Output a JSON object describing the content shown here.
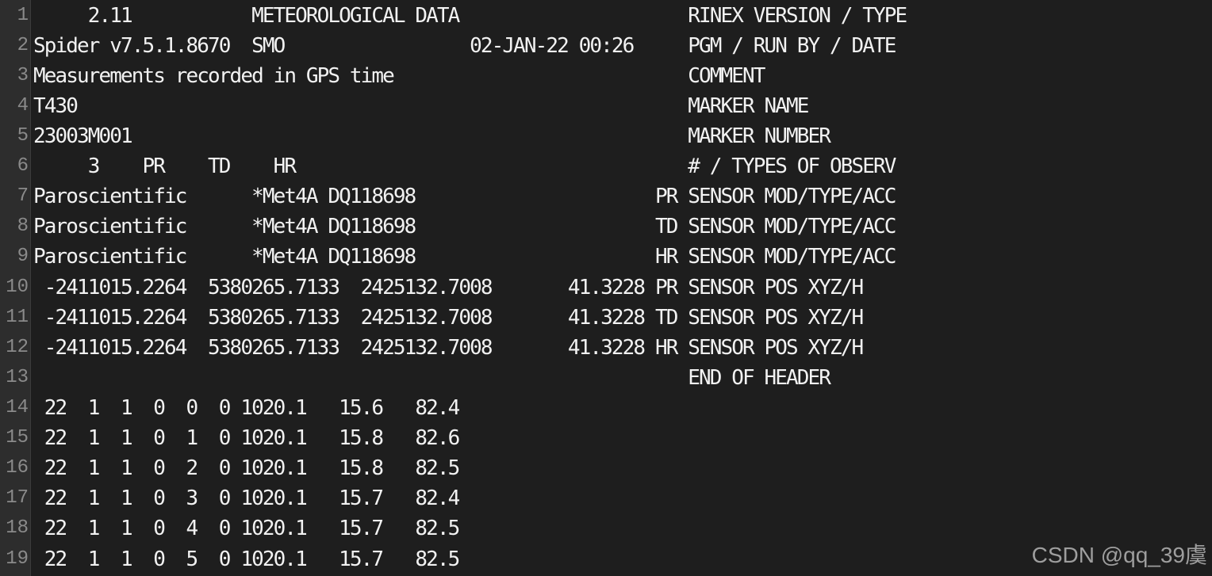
{
  "editor": {
    "lines": [
      {
        "number": "1",
        "text": "     2.11           METEOROLOGICAL DATA                     RINEX VERSION / TYPE"
      },
      {
        "number": "2",
        "text": "Spider v7.5.1.8670  SMO                 02-JAN-22 00:26     PGM / RUN BY / DATE"
      },
      {
        "number": "3",
        "text": "Measurements recorded in GPS time                           COMMENT"
      },
      {
        "number": "4",
        "text": "T430                                                        MARKER NAME"
      },
      {
        "number": "5",
        "text": "23003M001                                                   MARKER NUMBER"
      },
      {
        "number": "6",
        "text": "     3    PR    TD    HR                                    # / TYPES OF OBSERV"
      },
      {
        "number": "7",
        "text": "Paroscientific      *Met4A DQ118698                      PR SENSOR MOD/TYPE/ACC"
      },
      {
        "number": "8",
        "text": "Paroscientific      *Met4A DQ118698                      TD SENSOR MOD/TYPE/ACC"
      },
      {
        "number": "9",
        "text": "Paroscientific      *Met4A DQ118698                      HR SENSOR MOD/TYPE/ACC"
      },
      {
        "number": "10",
        "text": " -2411015.2264  5380265.7133  2425132.7008       41.3228 PR SENSOR POS XYZ/H"
      },
      {
        "number": "11",
        "text": " -2411015.2264  5380265.7133  2425132.7008       41.3228 TD SENSOR POS XYZ/H"
      },
      {
        "number": "12",
        "text": " -2411015.2264  5380265.7133  2425132.7008       41.3228 HR SENSOR POS XYZ/H"
      },
      {
        "number": "13",
        "text": "                                                            END OF HEADER"
      },
      {
        "number": "14",
        "text": " 22  1  1  0  0  0 1020.1   15.6   82.4"
      },
      {
        "number": "15",
        "text": " 22  1  1  0  1  0 1020.1   15.8   82.6"
      },
      {
        "number": "16",
        "text": " 22  1  1  0  2  0 1020.1   15.8   82.5"
      },
      {
        "number": "17",
        "text": " 22  1  1  0  3  0 1020.1   15.7   82.4"
      },
      {
        "number": "18",
        "text": " 22  1  1  0  4  0 1020.1   15.7   82.5"
      },
      {
        "number": "19",
        "text": " 22  1  1  0  5  0 1020.1   15.7   82.5"
      }
    ]
  },
  "watermark": "CSDN @qq_39虞",
  "colors": {
    "background": "#1e1e1e",
    "gutter": "#2d2d2d",
    "line_number": "#8a8a8a",
    "text": "#f2f2f2"
  }
}
